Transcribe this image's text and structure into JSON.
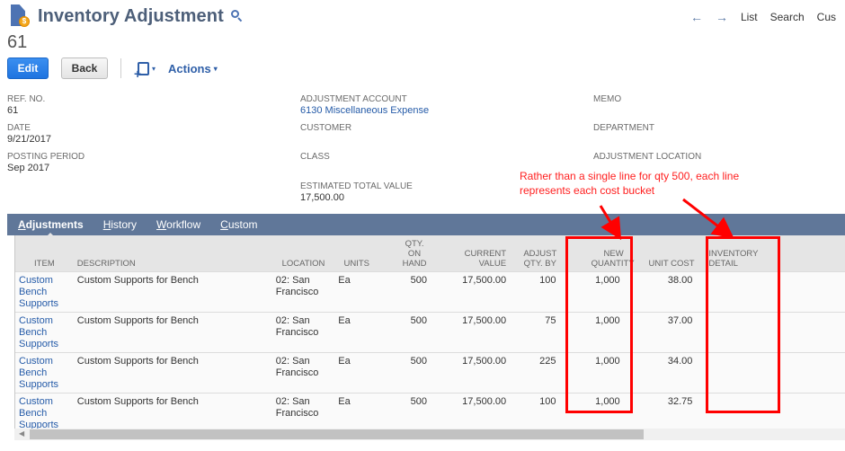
{
  "header": {
    "title": "Inventory Adjustment",
    "record_number": "61",
    "record_icon": "inventory-adjustment-record-icon",
    "search_icon": "magnifier-icon"
  },
  "top_nav": {
    "back_arrow": "←",
    "forward_arrow": "→",
    "links": [
      "List",
      "Search",
      "Cus"
    ]
  },
  "toolbar": {
    "edit_label": "Edit",
    "back_label": "Back",
    "new_icon": "new-document-icon",
    "actions_label": "Actions",
    "caret": "▾"
  },
  "fields": {
    "ref_no": {
      "label": "REF. NO.",
      "value": "61"
    },
    "date": {
      "label": "DATE",
      "value": "9/21/2017"
    },
    "posting_period": {
      "label": "POSTING PERIOD",
      "value": "Sep 2017"
    },
    "adjustment_account": {
      "label": "ADJUSTMENT ACCOUNT",
      "value": "6130 Miscellaneous Expense"
    },
    "customer": {
      "label": "CUSTOMER",
      "value": ""
    },
    "class": {
      "label": "CLASS",
      "value": ""
    },
    "estimated_total_value": {
      "label": "ESTIMATED TOTAL VALUE",
      "value": "17,500.00"
    },
    "memo": {
      "label": "MEMO",
      "value": ""
    },
    "department": {
      "label": "DEPARTMENT",
      "value": ""
    },
    "adjustment_location": {
      "label": "ADJUSTMENT LOCATION",
      "value": ""
    }
  },
  "annotation": {
    "text": "Rather than a single line for qty 500, each line represents each cost bucket",
    "color": "#ff0000"
  },
  "tabs": [
    {
      "label_first": "A",
      "label_rest": "djustments",
      "active": true
    },
    {
      "label_first": "H",
      "label_rest": "istory",
      "active": false
    },
    {
      "label_first": "W",
      "label_rest": "orkflow",
      "active": false
    },
    {
      "label_first": "C",
      "label_rest": "ustom",
      "active": false
    }
  ],
  "table": {
    "columns": {
      "item": "ITEM",
      "description": "DESCRIPTION",
      "location": "LOCATION",
      "units": "UNITS",
      "qty_on_hand_1": "QTY.",
      "qty_on_hand_2": "ON",
      "qty_on_hand_3": "HAND",
      "current_value_1": "CURRENT",
      "current_value_2": "VALUE",
      "adjust_qty_1": "ADJUST",
      "adjust_qty_2": "QTY. BY",
      "new_quantity_1": "NEW",
      "new_quantity_2": "QUANTITY",
      "unit_cost": "UNIT COST",
      "inventory_detail_1": "INVENTORY",
      "inventory_detail_2": "DETAIL"
    },
    "rows": [
      {
        "item_1": "Custom",
        "item_2": "Bench",
        "item_3": "Supports",
        "description": "Custom Supports for Bench",
        "location_1": "02: San",
        "location_2": "Francisco",
        "units": "Ea",
        "qty_on_hand": "500",
        "current_value": "17,500.00",
        "adjust_qty_by": "100",
        "new_quantity": "1,000",
        "unit_cost": "38.00",
        "inventory_detail": ""
      },
      {
        "item_1": "Custom",
        "item_2": "Bench",
        "item_3": "Supports",
        "description": "Custom Supports for Bench",
        "location_1": "02: San",
        "location_2": "Francisco",
        "units": "Ea",
        "qty_on_hand": "500",
        "current_value": "17,500.00",
        "adjust_qty_by": "75",
        "new_quantity": "1,000",
        "unit_cost": "37.00",
        "inventory_detail": ""
      },
      {
        "item_1": "Custom",
        "item_2": "Bench",
        "item_3": "Supports",
        "description": "Custom Supports for Bench",
        "location_1": "02: San",
        "location_2": "Francisco",
        "units": "Ea",
        "qty_on_hand": "500",
        "current_value": "17,500.00",
        "adjust_qty_by": "225",
        "new_quantity": "1,000",
        "unit_cost": "34.00",
        "inventory_detail": ""
      },
      {
        "item_1": "Custom",
        "item_2": "Bench",
        "item_3": "Supports",
        "description": "Custom Supports for Bench",
        "location_1": "02: San",
        "location_2": "Francisco",
        "units": "Ea",
        "qty_on_hand": "500",
        "current_value": "17,500.00",
        "adjust_qty_by": "100",
        "new_quantity": "1,000",
        "unit_cost": "32.75",
        "inventory_detail": ""
      }
    ]
  },
  "scrollbar": {
    "left_arrow": "◀"
  }
}
